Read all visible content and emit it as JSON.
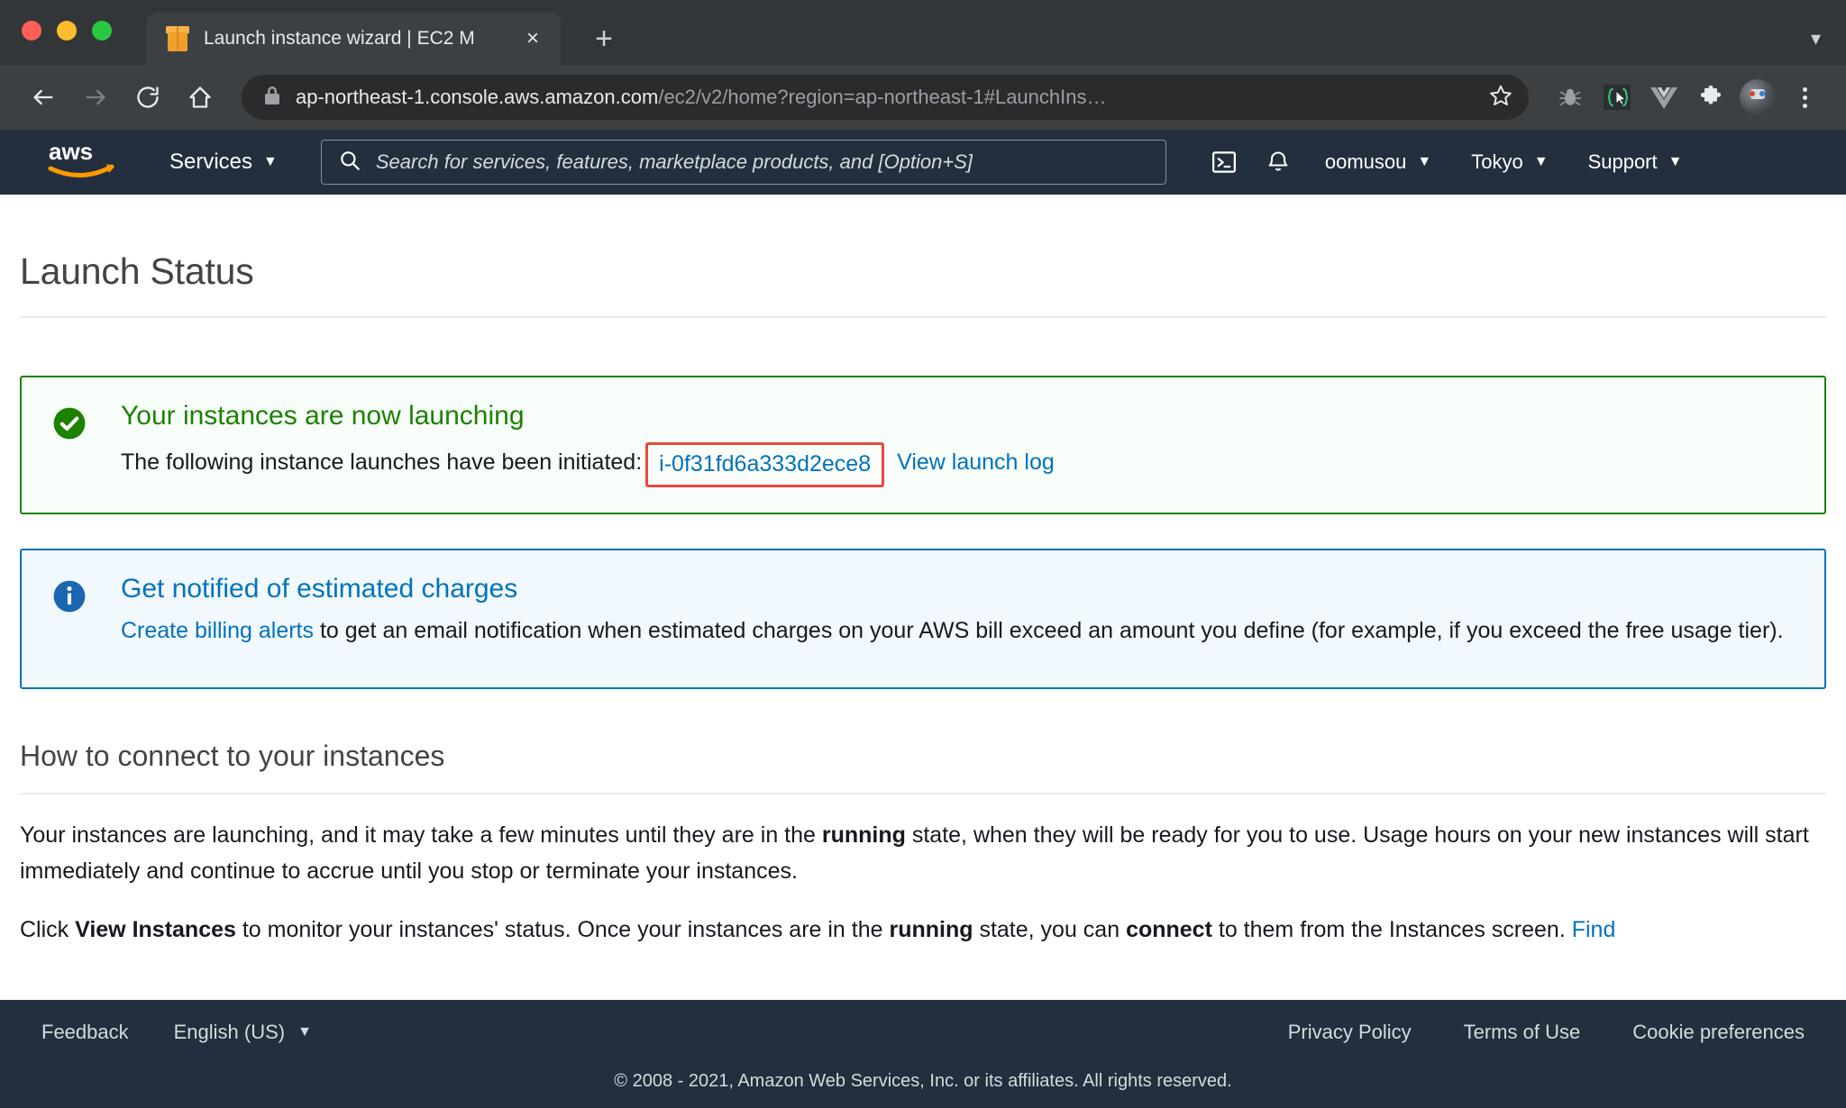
{
  "browser": {
    "tab": {
      "title": "Launch instance wizard | EC2 M",
      "favicon": "package-icon",
      "close": "×"
    },
    "newtab_label": "+",
    "tabstrip_chevron": "▾",
    "address": {
      "domain": "ap-northeast-1.console.aws.amazon.com",
      "path": "/ec2/v2/home?region=ap-northeast-1#LaunchIns…"
    },
    "nav": {
      "back": "back-arrow",
      "forward": "forward-arrow",
      "reload": "reload",
      "home": "home"
    },
    "extensions": [
      "bug-icon",
      "code-cursor-icon",
      "vue-icon",
      "puzzle-icon"
    ],
    "profile": "user-avatar",
    "menu": "kebab-menu"
  },
  "aws_nav": {
    "logo_alt": "aws",
    "services_label": "Services",
    "caret": "▼",
    "search_placeholder": "Search for services, features, marketplace products, and  [Option+S]",
    "cloudshell": "cloudshell-icon",
    "notifications": "bell-icon",
    "account": "oomusou",
    "region": "Tokyo",
    "support": "Support"
  },
  "page": {
    "title": "Launch Status",
    "success_alert": {
      "icon": "check-circle-icon",
      "title": "Your instances are now launching",
      "text_prefix": "The following instance launches have been initiated:",
      "instance_id": "i-0f31fd6a333d2ece8",
      "view_log_link": "View launch log",
      "highlight_color": "#e8493f",
      "accent_color": "#1d8102"
    },
    "info_alert": {
      "icon": "info-circle-icon",
      "title": "Get notified of estimated charges",
      "link": "Create billing alerts",
      "text": " to get an email notification when estimated charges on your AWS bill exceed an amount you define (for example, if you exceed the free usage tier).",
      "accent_color": "#0073bb"
    },
    "connect_section": {
      "title": "How to connect to your instances",
      "para1_a": "Your instances are launching, and it may take a few minutes until they are in the ",
      "para1_bold": "running",
      "para1_b": " state, when they will be ready for you to use. Usage hours on your new instances will start immediately and continue to accrue until you stop or terminate your instances.",
      "para2_a": "Click ",
      "para2_bold1": "View Instances",
      "para2_b": " to monitor your instances' status. Once your instances are in the ",
      "para2_bold2": "running",
      "para2_c": " state, you can ",
      "para2_bold3": "connect",
      "para2_d": " to them from the Instances screen. ",
      "para2_link": "Find"
    }
  },
  "footer": {
    "feedback": "Feedback",
    "language": "English (US)",
    "language_caret": "▼",
    "privacy": "Privacy Policy",
    "terms": "Terms of Use",
    "cookies": "Cookie preferences",
    "copyright": "© 2008 - 2021, Amazon Web Services, Inc. or its affiliates. All rights reserved."
  }
}
